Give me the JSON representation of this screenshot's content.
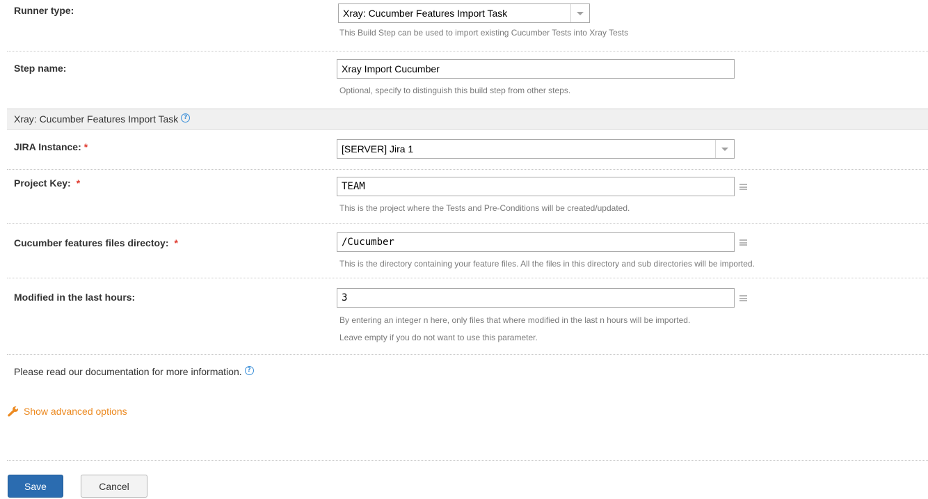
{
  "runner_type": {
    "label": "Runner type:",
    "selected": "Xray: Cucumber Features Import Task",
    "help": "This Build Step can be used to import existing Cucumber Tests into Xray Tests"
  },
  "step_name": {
    "label": "Step name:",
    "value": "Xray Import Cucumber",
    "help": "Optional, specify to distinguish this build step from other steps."
  },
  "section": {
    "title": "Xray: Cucumber Features Import Task",
    "help_glyph": "?"
  },
  "jira_instance": {
    "label": "JIRA Instance:",
    "required": "*",
    "selected": "[SERVER] Jira 1"
  },
  "project_key": {
    "label": "Project Key:",
    "required": "*",
    "value": "TEAM",
    "help": "This is the project where the Tests and Pre-Conditions will be created/updated."
  },
  "features_dir": {
    "label": "Cucumber features files directoy:",
    "required": "*",
    "value": "/Cucumber",
    "help": "This is the directory containing your feature files. All the files in this directory and sub directories will be imported."
  },
  "modified_hours": {
    "label": "Modified in the last hours:",
    "value": "3",
    "help_line1": "By entering an integer n here, only files that where modified in the last n hours will be imported.",
    "help_line2": "Leave empty if you do not want to use this parameter."
  },
  "documentation": {
    "text": "Please read our documentation for more information.",
    "help_glyph": "?"
  },
  "advanced": {
    "label": "Show advanced options",
    "icon": "wrench-icon"
  },
  "buttons": {
    "save": "Save",
    "cancel": "Cancel"
  },
  "colors": {
    "accent_orange": "#ec8a21",
    "save_blue": "#2b6cb0",
    "help_blue": "#3b8fd8",
    "required_red": "#e03c31"
  }
}
